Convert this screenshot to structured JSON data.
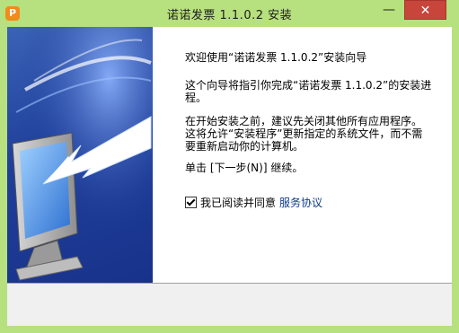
{
  "window": {
    "title": "诺诺发票 1.1.0.2 安装",
    "app_icon_glyph": "P",
    "minimize_glyph": "—",
    "close_glyph": "✕"
  },
  "content": {
    "welcome": "欢迎使用“诺诺发票 1.1.0.2”安装向导",
    "guide": "这个向导将指引你完成“诺诺发票 1.1.0.2”的安装进程。",
    "advice": "在开始安装之前，建议先关闭其他所有应用程序。这将允许“安装程序”更新指定的系统文件，而不需要重新启动你的计算机。",
    "next_hint": "单击 [下一步(N)] 继续。",
    "agree_label": "我已阅读并同意",
    "agree_link": "服务协议",
    "agree_checked": true
  },
  "colors": {
    "titlebar": "#b7e07e",
    "close_button": "#c7453b",
    "panel_blue": "#1f3f9b",
    "link": "#0f3c8c"
  }
}
